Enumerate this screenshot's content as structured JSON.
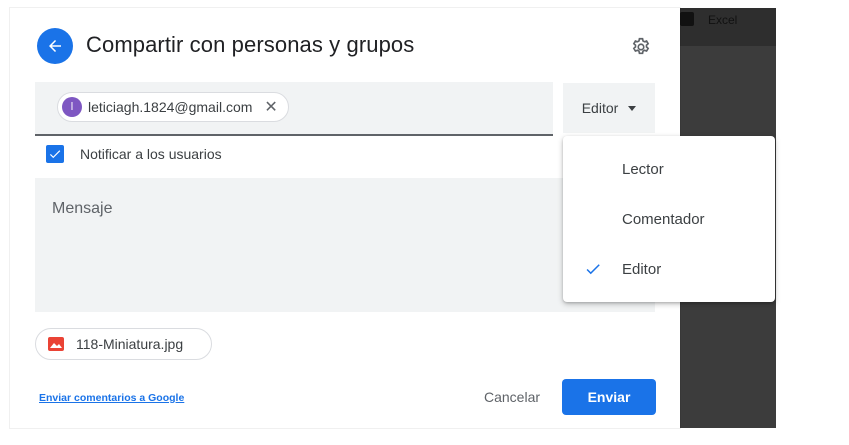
{
  "backdrop": {
    "app_label": "Excel"
  },
  "dialog": {
    "title": "Compartir con personas y grupos",
    "recipient": {
      "avatar_letter": "l",
      "email": "leticiagh.1824@gmail.com",
      "remove_glyph": "✕"
    },
    "role_button": {
      "label": "Editor"
    },
    "notify": {
      "label": "Notificar a los usuarios",
      "checked": true
    },
    "message": {
      "placeholder": "Mensaje"
    },
    "attachment": {
      "name": "118-Miniatura.jpg"
    },
    "footer": {
      "feedback_link": "Enviar comentarios a Google",
      "cancel_label": "Cancelar",
      "send_label": "Enviar"
    }
  },
  "role_menu": {
    "items": [
      {
        "label": "Lector",
        "selected": false
      },
      {
        "label": "Comentador",
        "selected": false
      },
      {
        "label": "Editor",
        "selected": true
      }
    ]
  },
  "colors": {
    "accent": "#1a73e8",
    "avatar": "#7e57c2",
    "file_icon": "#ea4335"
  },
  "icons": {
    "back": "arrow-back-icon",
    "settings": "gear-icon",
    "remove": "close-icon",
    "dropdown": "caret-down-icon",
    "checkbox": "checkbox-checked-icon",
    "file": "image-file-icon",
    "selected": "checkmark-icon"
  }
}
